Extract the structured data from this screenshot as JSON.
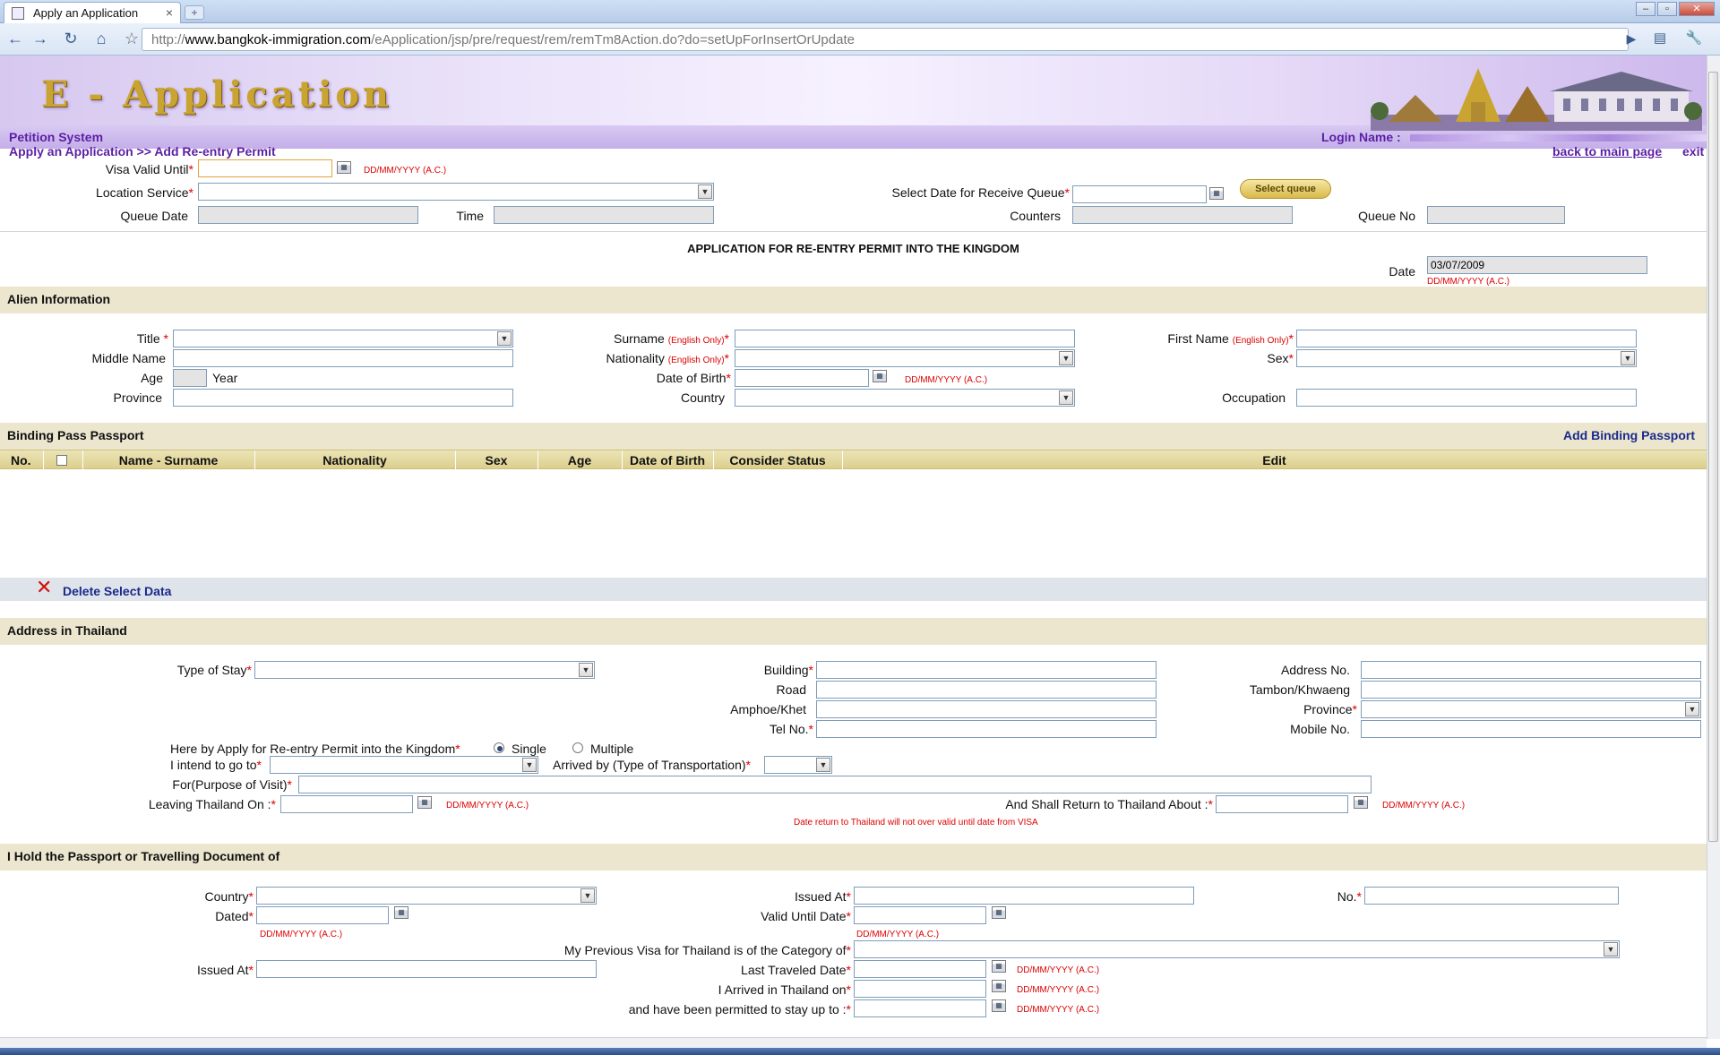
{
  "browser": {
    "tab_title": "Apply an Application",
    "url_prefix": "http://",
    "url_host": "www.bangkok-immigration.com",
    "url_path": "/eApplication/jsp/pre/request/rem/remTm8Action.do?do=setUpForInsertOrUpdate"
  },
  "header": {
    "app_title": "E - Application",
    "system_name": "Petition System",
    "breadcrumb": "Apply an Application >> Add Re-entry Permit",
    "login_label": "Login Name :",
    "back_link": "back to main page",
    "exit_link": "exit"
  },
  "queue": {
    "visa_valid_until": "Visa Valid Until",
    "date_hint": "DD/MM/YYYY (A.C.)",
    "location_service": "Location Service",
    "select_date_receive_queue": "Select Date for Receive Queue",
    "select_queue_button": "Select queue",
    "queue_date": "Queue Date",
    "time": "Time",
    "counters": "Counters",
    "queue_no": "Queue No"
  },
  "form_title": "APPLICATION FOR RE-ENTRY PERMIT INTO THE KINGDOM",
  "date_label": "Date",
  "date_value": "03/07/2009",
  "alien": {
    "section": "Alien Information",
    "title": "Title",
    "middle_name": "Middle Name",
    "age": "Age",
    "year": "Year",
    "province": "Province",
    "surname": "Surname",
    "english_only": "(English Only)",
    "nationality": "Nationality",
    "dob": "Date of Birth",
    "country": "Country",
    "first_name": "First Name",
    "sex": "Sex",
    "occupation": "Occupation"
  },
  "binding": {
    "section": "Binding Pass Passport",
    "add_link": "Add Binding Passport",
    "columns": [
      "No.",
      "Name - Surname",
      "Nationality",
      "Sex",
      "Age",
      "Date of Birth",
      "Consider Status",
      "Edit"
    ],
    "delete_label": "Delete Select Data"
  },
  "address": {
    "section": "Address in Thailand",
    "type_of_stay": "Type of Stay",
    "building": "Building",
    "road": "Road",
    "amphoe": "Amphoe/Khet",
    "tel": "Tel No.",
    "address_no": "Address No.",
    "tambon": "Tambon/Khwaeng",
    "province": "Province",
    "mobile": "Mobile No.",
    "apply_for": "Here by Apply for Re-entry Permit into the Kingdom",
    "single": "Single",
    "multiple": "Multiple",
    "intend_to_go": "I intend to go to",
    "arrived_by": "Arrived by (Type of Transportation)",
    "purpose": "For(Purpose of Visit)",
    "leaving_on": "Leaving Thailand On :",
    "return_about": "And Shall Return to Thailand About :",
    "return_note": "Date return to Thailand will not over valid until date from VISA"
  },
  "passport": {
    "section": "I Hold the Passport or Travelling Document of",
    "country": "Country",
    "dated": "Dated",
    "issued_at": "Issued At",
    "valid_until": "Valid Until Date",
    "no": "No.",
    "previous_visa": "My Previous Visa for Thailand is of the Category of",
    "issued_at2": "Issued At",
    "last_traveled": "Last Traveled Date",
    "arrived_on": "I Arrived in Thailand on",
    "permitted_stay": "and have been permitted to stay up to :"
  },
  "colors": {
    "accent_purple": "#5b1fa5",
    "link_blue": "#1a2a8c",
    "required_red": "#dd0000",
    "section_bg": "#ece6cf"
  }
}
